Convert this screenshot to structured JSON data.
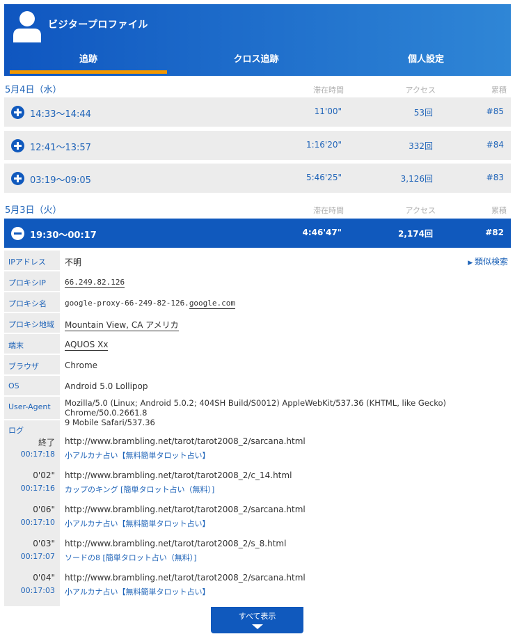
{
  "header": {
    "title": "ビジタープロファイル"
  },
  "tabs": [
    {
      "label": "追跡",
      "active": true
    },
    {
      "label": "クロス追跡",
      "active": false
    },
    {
      "label": "個人設定",
      "active": false
    }
  ],
  "columns": {
    "stay": "滞在時間",
    "access": "アクセス",
    "total": "累積"
  },
  "days": [
    {
      "date": "5月4日（水）"
    },
    {
      "date": "5月3日（火）"
    }
  ],
  "sessions": [
    {
      "time": "14:33～14:44",
      "stay": "11'00\"",
      "access": "53回",
      "total": "#85"
    },
    {
      "time": "12:41～13:57",
      "stay": "1:16'20\"",
      "access": "332回",
      "total": "#84"
    },
    {
      "time": "03:19～09:05",
      "stay": "5:46'25\"",
      "access": "3,126回",
      "total": "#83"
    },
    {
      "time": "19:30～00:17",
      "stay": "4:46'47\"",
      "access": "2,174回",
      "total": "#82"
    }
  ],
  "detail": {
    "ip_label": "IPアドレス",
    "ip_value": "不明",
    "similar_search": "類似検索",
    "proxy_ip_label": "プロキシIP",
    "proxy_ip_value": "66.249.82.126",
    "proxy_name_label": "プロキシ名",
    "proxy_name_value": "google-proxy-66-249-82-126.",
    "proxy_name_domain": "google.com",
    "proxy_region_label": "プロキシ地域",
    "proxy_region_value": "Mountain View, CA アメリカ",
    "device_label": "端末",
    "device_value": "AQUOS Xx",
    "browser_label": "ブラウザ",
    "browser_value": "Chrome",
    "os_label": "OS",
    "os_value": "Android 5.0 Lollipop",
    "ua_label": "User-Agent",
    "ua_line1": "Mozilla/5.0 (Linux; Android 5.0.2; 404SH Build/S0012) AppleWebKit/537.36 (KHTML, like Gecko) Chrome/50.0.2661.8",
    "ua_line2": "9 Mobile Safari/537.36",
    "log_label": "ログ"
  },
  "log": [
    {
      "delta": "終了",
      "clock": "00:17:18",
      "url": "http://www.brambling.net/tarot/tarot2008_2/sarcana.html",
      "title": "小アルカナ占い【無料簡単タロット占い】"
    },
    {
      "delta": "0'02\"",
      "clock": "00:17:16",
      "url": "http://www.brambling.net/tarot/tarot2008_2/c_14.html",
      "title": "カップのキング [簡単タロット占い（無料）]"
    },
    {
      "delta": "0'06\"",
      "clock": "00:17:10",
      "url": "http://www.brambling.net/tarot/tarot2008_2/sarcana.html",
      "title": "小アルカナ占い【無料簡単タロット占い】"
    },
    {
      "delta": "0'03\"",
      "clock": "00:17:07",
      "url": "http://www.brambling.net/tarot/tarot2008_2/s_8.html",
      "title": "ソードの8 [簡単タロット占い（無料）]"
    },
    {
      "delta": "0'04\"",
      "clock": "00:17:03",
      "url": "http://www.brambling.net/tarot/tarot2008_2/sarcana.html",
      "title": "小アルカナ占い【無料簡単タロット占い】"
    }
  ],
  "show_all": "すべて表示"
}
